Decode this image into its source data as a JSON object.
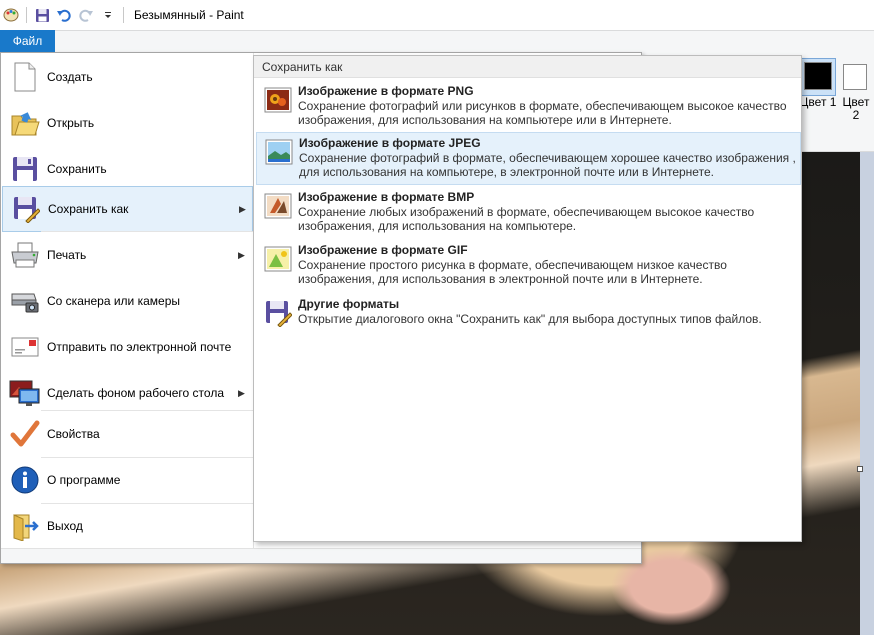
{
  "window": {
    "title": "Безымянный - Paint"
  },
  "ribbon": {
    "file_tab": "Файл",
    "color1_label": "Цвет 1",
    "color2_label": "Цвет 2",
    "color1_hex": "#000000",
    "color2_hex": "#ffffff"
  },
  "file_menu": {
    "items": [
      {
        "label": "Создать",
        "icon": "new-document-icon",
        "submenu": false
      },
      {
        "label": "Открыть",
        "icon": "open-folder-icon",
        "submenu": false
      },
      {
        "label": "Сохранить",
        "icon": "save-disk-icon",
        "submenu": false
      },
      {
        "label": "Сохранить как",
        "icon": "save-as-icon",
        "submenu": true,
        "selected": true
      },
      {
        "label": "Печать",
        "icon": "printer-icon",
        "submenu": true
      },
      {
        "label": "Со сканера или камеры",
        "icon": "scanner-icon",
        "submenu": false
      },
      {
        "label": "Отправить по электронной почте",
        "icon": "email-icon",
        "submenu": false
      },
      {
        "label": "Сделать фоном рабочего стола",
        "icon": "desktop-background-icon",
        "submenu": true
      },
      {
        "label": "Свойства",
        "icon": "checkmark-icon",
        "submenu": false
      },
      {
        "label": "О программе",
        "icon": "info-icon",
        "submenu": false
      },
      {
        "label": "Выход",
        "icon": "exit-icon",
        "submenu": false
      }
    ]
  },
  "save_as_submenu": {
    "header": "Сохранить как",
    "items": [
      {
        "title": "Изображение в формате PNG",
        "desc": "Сохранение фотографий или рисунков в формате, обеспечивающем высокое качество изображения, для использования на компьютере или в Интернете.",
        "icon": "png-image-icon"
      },
      {
        "title": "Изображение в формате JPEG",
        "desc": "Сохранение фотографий в формате, обеспечивающем хорошее качество изображения , для использования на компьютере, в электронной почте или в Интернете.",
        "icon": "jpeg-image-icon",
        "selected": true
      },
      {
        "title": "Изображение в формате BMP",
        "desc": "Сохранение любых изображений в формате, обеспечивающем высокое качество изображения, для использования на компьютере.",
        "icon": "bmp-image-icon"
      },
      {
        "title": "Изображение в формате GIF",
        "desc": "Сохранение простого рисунка в формате, обеспечивающем низкое качество изображения, для использования в электронной почте или в Интернете.",
        "icon": "gif-image-icon"
      },
      {
        "title": "Другие форматы",
        "desc": "Открытие диалогового окна \"Сохранить как\" для выбора доступных типов файлов.",
        "icon": "other-formats-icon"
      }
    ]
  }
}
